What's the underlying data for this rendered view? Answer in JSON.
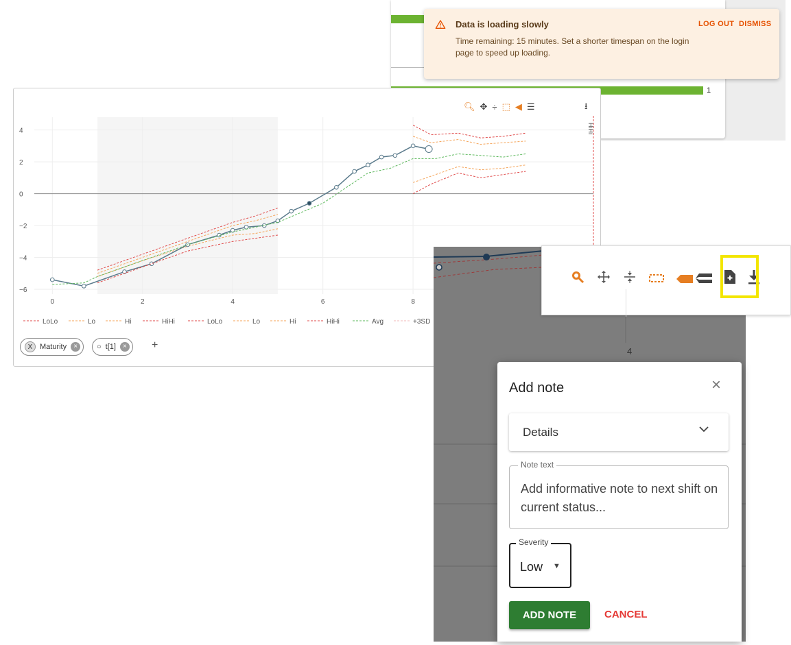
{
  "toast": {
    "title": "Data is loading slowly",
    "message": "Time remaining: 15 minutes. Set a shorter timespan on the login page to speed up loading.",
    "logout_label": "LOG OUT",
    "dismiss_label": "DISMISS"
  },
  "background_card": {
    "count": "1"
  },
  "chart": {
    "side_label": "HiHi",
    "legend": [
      {
        "label": "LoLo",
        "color": "#e04b4b"
      },
      {
        "label": "Lo",
        "color": "#f5a55a"
      },
      {
        "label": "Hi",
        "color": "#f5a55a"
      },
      {
        "label": "HiHi",
        "color": "#e04b4b"
      },
      {
        "label": "LoLo",
        "color": "#e04b4b"
      },
      {
        "label": "Lo",
        "color": "#f5a55a"
      },
      {
        "label": "Hi",
        "color": "#f5a55a"
      },
      {
        "label": "HiHi",
        "color": "#e04b4b"
      },
      {
        "label": "Avg",
        "color": "#5cb85c"
      },
      {
        "label": "+3SD",
        "color": "#f2b8b8"
      }
    ],
    "chips": [
      {
        "lead": "X",
        "label": "Maturity"
      },
      {
        "lead": "○",
        "label": "t[1]"
      }
    ],
    "add_label": "+"
  },
  "chart_data": {
    "type": "line",
    "xlim": [
      -0.4,
      12
    ],
    "ylim": [
      -6.3,
      4.8
    ],
    "x_ticks": [
      0,
      2,
      4,
      6,
      8
    ],
    "y_ticks": [
      4,
      2,
      0,
      -2,
      -4,
      -6
    ],
    "series": [
      {
        "name": "t[1]",
        "color": "#5b7b8c",
        "x": [
          0,
          0.7,
          1.6,
          2.2,
          3.0,
          3.7,
          4.0,
          4.3,
          4.7,
          5.0,
          5.3,
          5.7,
          6.3,
          6.7,
          7.0,
          7.3,
          7.6,
          8.0,
          8.35
        ],
        "y": [
          -5.4,
          -5.8,
          -4.9,
          -4.4,
          -3.2,
          -2.6,
          -2.3,
          -2.1,
          -2.0,
          -1.7,
          -1.1,
          -0.6,
          0.4,
          1.4,
          1.8,
          2.3,
          2.4,
          3.0,
          2.8
        ]
      },
      {
        "name": "Avg",
        "color": "#5cb85c",
        "x": [
          0,
          0.7,
          1.0,
          2.0,
          3.0,
          4.0,
          5.0,
          6.0,
          7.0,
          7.5,
          8.0,
          8.5,
          9.0,
          9.5,
          10.0,
          10.5
        ],
        "y": [
          -5.7,
          -5.6,
          -5.2,
          -4.2,
          -3.2,
          -2.4,
          -1.8,
          -0.6,
          1.3,
          1.6,
          2.2,
          2.2,
          2.5,
          2.4,
          2.3,
          2.5
        ]
      },
      {
        "name": "LoLo",
        "color": "#e04b4b",
        "x": [
          1.0,
          2.0,
          3.0,
          4.0,
          4.5,
          5.0
        ],
        "y": [
          -5.6,
          -4.6,
          -3.6,
          -3.0,
          -2.8,
          -2.6
        ]
      },
      {
        "name": "HiHi",
        "color": "#e04b4b",
        "x": [
          1.0,
          2.0,
          3.0,
          4.0,
          4.5,
          5.0
        ],
        "y": [
          -4.8,
          -3.8,
          -2.8,
          -1.8,
          -1.4,
          -0.9
        ]
      },
      {
        "name": "LoLo",
        "color": "#e04b4b",
        "x": [
          8.0,
          8.4,
          9.0,
          9.5,
          10.0,
          10.5
        ],
        "y": [
          0.0,
          0.6,
          1.3,
          1.0,
          1.2,
          1.4
        ]
      },
      {
        "name": "HiHi",
        "color": "#e04b4b",
        "x": [
          8.0,
          8.4,
          9.0,
          9.5,
          10.0,
          10.5
        ],
        "y": [
          4.3,
          3.7,
          3.8,
          3.5,
          3.6,
          3.8
        ]
      }
    ]
  },
  "zoom_toolbar": {
    "icons": [
      "zoom-icon",
      "pan-icon",
      "compress-icon",
      "select-icon",
      "tag-icon",
      "stack-icon",
      "add-note-icon",
      "download-icon"
    ]
  },
  "overlay": {
    "axis_tick": "4"
  },
  "dialog": {
    "title": "Add note",
    "close_label": "×",
    "details_label": "Details",
    "note_legend": "Note text",
    "note_placeholder": "Add informative note to next shift on current status...",
    "severity_legend": "Severity",
    "severity_value": "Low",
    "add_label": "ADD NOTE",
    "cancel_label": "CANCEL"
  }
}
